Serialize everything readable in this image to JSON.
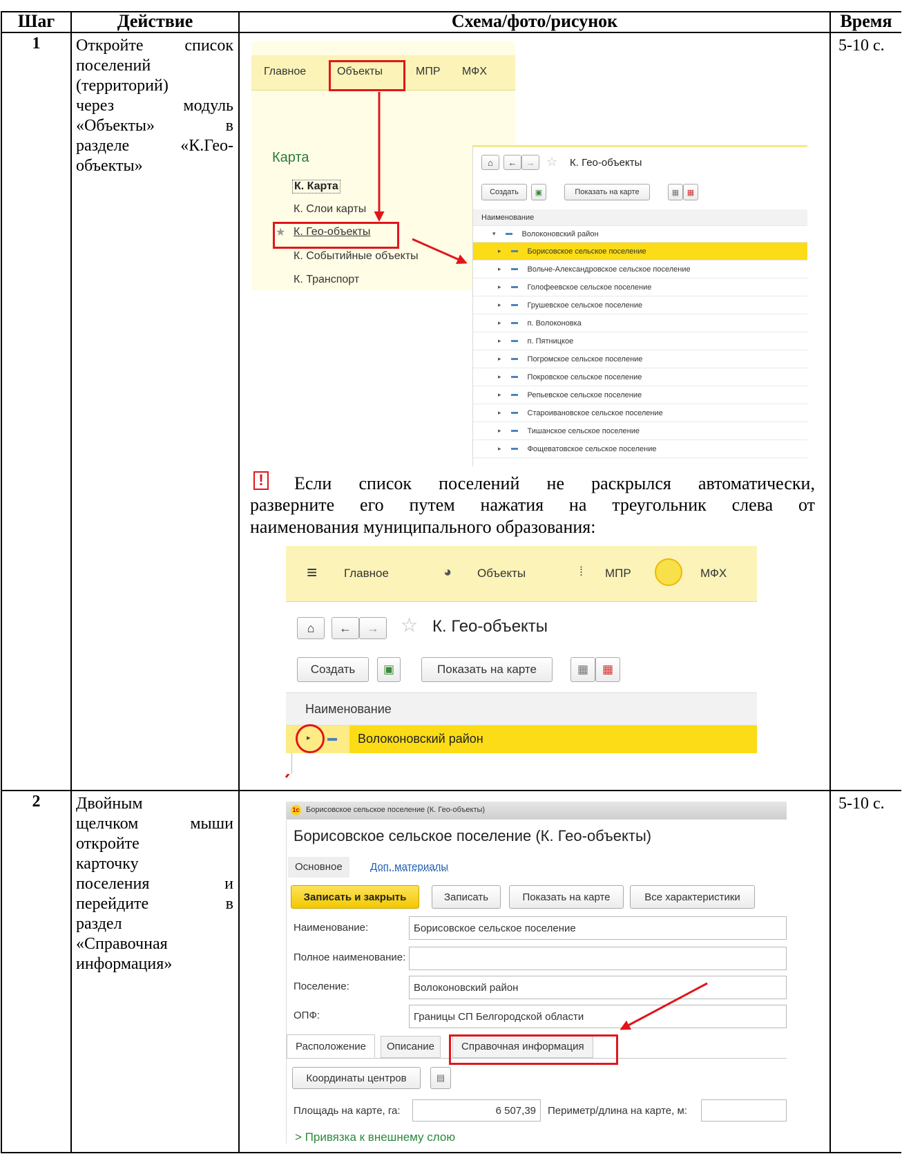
{
  "headers": {
    "step": "Шаг",
    "action": "Действие",
    "schema": "Схема/фото/рисунок",
    "time": "Время"
  },
  "row1": {
    "num": "1",
    "action_lines": [
      "Откройте список",
      "поселений",
      "(территорий)",
      "через модуль",
      "«Объекты» в",
      "разделе «К.Гео-",
      "объекты»"
    ],
    "time": "5-10 с.",
    "shot_a": {
      "menu": [
        "Главное",
        "Объекты",
        "МПР",
        "МФХ"
      ],
      "section_title": "Карта",
      "items": [
        "К. Карта",
        "К. Слои карты",
        "К. Гео-объекты",
        "К. Событийные объекты",
        "К. Транспорт"
      ]
    },
    "shot_b": {
      "title": "К. Гео-объекты",
      "create_btn": "Создать",
      "show_map_btn": "Показать на карте",
      "col_header": "Наименование",
      "root": "Волоконовский район",
      "items": [
        "Борисовское сельское поселение",
        "Вольче-Александровское сельское поселение",
        "Голофеевское сельское поселение",
        "Грушевское сельское поселение",
        "п. Волоконовка",
        "п. Пятницкое",
        "Погромское сельское поселение",
        "Покровское сельское поселение",
        "Репьевское сельское поселение",
        "Староивановское сельское поселение",
        "Тишанское сельское поселение",
        "Фощеватовское сельское поселение"
      ]
    },
    "note": {
      "mark": "!",
      "line1_words": [
        "Если",
        "список",
        "поселений",
        "не",
        "раскрылся",
        "автоматически,"
      ],
      "line2_words": [
        "разверните",
        "его",
        "путем",
        "нажатия",
        "на",
        "треугольник",
        "слева",
        "от"
      ],
      "line3": "наименования муниципального образования:"
    },
    "shot_c": {
      "menu": [
        "Главное",
        "Объекты",
        "МПР",
        "МФХ"
      ],
      "title": "К. Гео-объекты",
      "create_btn": "Создать",
      "show_map_btn": "Показать на карте",
      "col_header": "Наименование",
      "root": "Волоконовский район"
    }
  },
  "row2": {
    "num": "2",
    "action_lines": [
      "Двойным",
      "щелчком мыши",
      "откройте",
      "карточку",
      "поселения и",
      "перейдите в",
      "раздел",
      "«Справочная",
      "информация»"
    ],
    "time": "5-10 с.",
    "shot": {
      "window_title": "Борисовское сельское поселение (К. Гео-объекты)",
      "heading": "Борисовское сельское поселение (К. Гео-объекты)",
      "tab_main": "Основное",
      "tab_extra": "Доп. материалы",
      "btn_save_close": "Записать и закрыть",
      "btn_save": "Записать",
      "btn_show_map": "Показать на карте",
      "btn_all_chars": "Все характеристики",
      "label_name": "Наименование:",
      "value_name": "Борисовское сельское поселение",
      "label_fullname": "Полное наименование:",
      "value_fullname": "",
      "label_settlement": "Поселение:",
      "value_settlement": "Волоконовский район",
      "label_opf": "ОПФ:",
      "value_opf": "Границы СП Белгородской области",
      "tabs": [
        "Расположение",
        "Описание",
        "Справочная информация"
      ],
      "btn_coords": "Координаты центров",
      "label_area": "Площадь на карте, га:",
      "value_area": "6 507,39",
      "label_perimeter": "Периметр/длина на карте, м:",
      "link_binding": "> Привязка к внешнему слою"
    }
  }
}
